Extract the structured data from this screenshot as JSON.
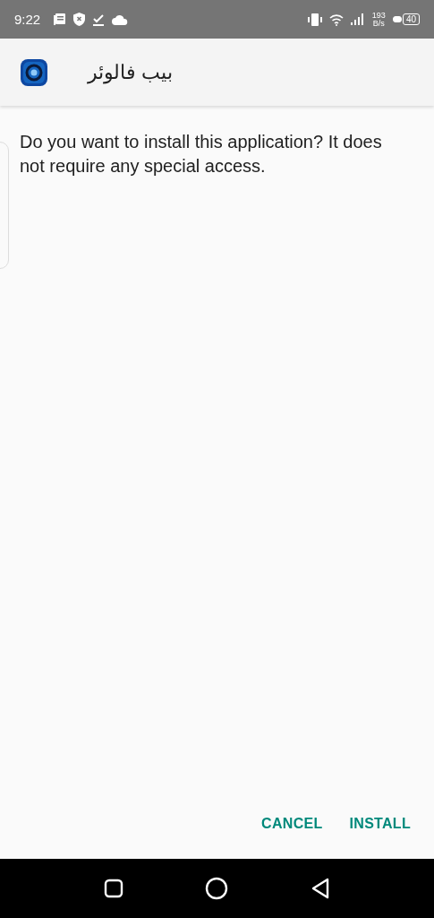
{
  "status_bar": {
    "time": "9:22",
    "net_speed": "193",
    "net_unit": "B/s",
    "battery": "40"
  },
  "header": {
    "app_name": "بيب فالوئر"
  },
  "message": "Do you want to install this application? It does not require any special access.",
  "buttons": [
    "CANCEL",
    "INSTALL"
  ]
}
